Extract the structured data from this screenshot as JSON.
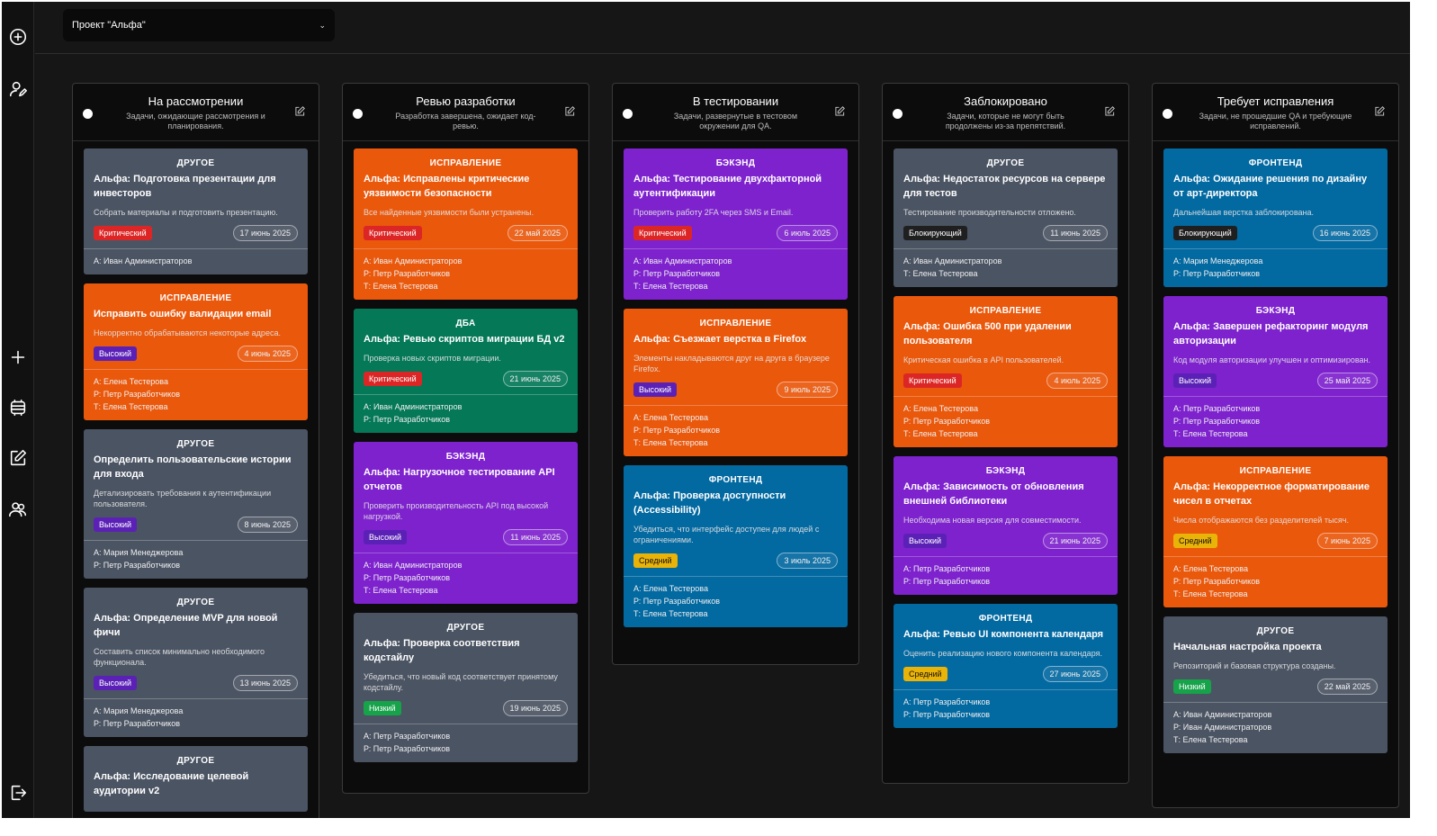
{
  "project_select": {
    "label": "Проект \"Альфа\""
  },
  "columns": [
    {
      "title": "На рассмотрении",
      "desc": "Задачи, ожидающие рассмотрения и планирования.",
      "cards": [
        {
          "type": "ДРУГОЕ",
          "color": "gray",
          "title": "Альфа: Подготовка презентации для инвесторов",
          "desc": "Собрать материалы и подготовить презентацию.",
          "priority": "Критический",
          "prio_class": "critical",
          "date": "17 июнь 2025",
          "people": [
            "А: Иван Администраторов"
          ]
        },
        {
          "type": "ИСПРАВЛЕНИЕ",
          "color": "orange",
          "title": "Исправить ошибку валидации email",
          "desc": "Некорректно обрабатываются некоторые адреса.",
          "priority": "Высокий",
          "prio_class": "high",
          "date": "4 июнь 2025",
          "people": [
            "А: Елена Тестерова",
            "Р: Петр Разработчиков",
            "Т: Елена Тестерова"
          ]
        },
        {
          "type": "ДРУГОЕ",
          "color": "gray",
          "title": "Определить пользовательские истории для входа",
          "desc": "Детализировать требования к аутентификации пользователя.",
          "priority": "Высокий",
          "prio_class": "high",
          "date": "8 июнь 2025",
          "people": [
            "А: Мария Менеджерова",
            "Р: Петр Разработчиков"
          ]
        },
        {
          "type": "ДРУГОЕ",
          "color": "gray",
          "title": "Альфа: Определение MVP для новой фичи",
          "desc": "Составить список минимально необходимого функционала.",
          "priority": "Высокий",
          "prio_class": "high",
          "date": "13 июнь 2025",
          "people": [
            "А: Мария Менеджерова",
            "Р: Петр Разработчиков"
          ]
        },
        {
          "type": "ДРУГОЕ",
          "color": "gray",
          "title": "Альфа: Исследование целевой аудитории v2",
          "desc": "",
          "priority": "",
          "prio_class": "",
          "date": "",
          "people": []
        }
      ]
    },
    {
      "title": "Ревью разработки",
      "desc": "Разработка завершена, ожидает код-ревью.",
      "cards": [
        {
          "type": "ИСПРАВЛЕНИЕ",
          "color": "orange",
          "title": "Альфа: Исправлены критические уязвимости безопасности",
          "desc": "Все найденные уязвимости были устранены.",
          "priority": "Критический",
          "prio_class": "critical",
          "date": "22 май 2025",
          "people": [
            "А: Иван Администраторов",
            "Р: Петр Разработчиков",
            "Т: Елена Тестерова"
          ]
        },
        {
          "type": "ДБА",
          "color": "green",
          "title": "Альфа: Ревью скриптов миграции БД v2",
          "desc": "Проверка новых скриптов миграции.",
          "priority": "Критический",
          "prio_class": "critical",
          "date": "21 июнь 2025",
          "people": [
            "А: Иван Администраторов",
            "Р: Петр Разработчиков"
          ]
        },
        {
          "type": "БЭКЭНД",
          "color": "purple",
          "title": "Альфа: Нагрузочное тестирование API отчетов",
          "desc": "Проверить производительность API под высокой нагрузкой.",
          "priority": "Высокий",
          "prio_class": "high",
          "date": "11 июнь 2025",
          "people": [
            "А: Иван Администраторов",
            "Р: Петр Разработчиков",
            "Т: Елена Тестерова"
          ]
        },
        {
          "type": "ДРУГОЕ",
          "color": "gray",
          "title": "Альфа: Проверка соответствия кодстайлу",
          "desc": "Убедиться, что новый код соответствует принятому кодстайлу.",
          "priority": "Низкий",
          "prio_class": "low",
          "date": "19 июнь 2025",
          "people": [
            "А: Петр Разработчиков",
            "Р: Петр Разработчиков"
          ]
        }
      ]
    },
    {
      "title": "В тестировании",
      "desc": "Задачи, развернутые в тестовом окружении для QA.",
      "cards": [
        {
          "type": "БЭКЭНД",
          "color": "purple",
          "title": "Альфа: Тестирование двухфакторной аутентификации",
          "desc": "Проверить работу 2FA через SMS и Email.",
          "priority": "Критический",
          "prio_class": "critical",
          "date": "6 июль 2025",
          "people": [
            "А: Иван Администраторов",
            "Р: Петр Разработчиков",
            "Т: Елена Тестерова"
          ]
        },
        {
          "type": "ИСПРАВЛЕНИЕ",
          "color": "orange",
          "title": "Альфа: Съезжает верстка в Firefox",
          "desc": "Элементы накладываются друг на друга в браузере Firefox.",
          "priority": "Высокий",
          "prio_class": "high",
          "date": "9 июль 2025",
          "people": [
            "А: Елена Тестерова",
            "Р: Петр Разработчиков",
            "Т: Елена Тестерова"
          ]
        },
        {
          "type": "ФРОНТЕНД",
          "color": "blue",
          "title": "Альфа: Проверка доступности (Accessibility)",
          "desc": "Убедиться, что интерфейс доступен для людей с ограничениями.",
          "priority": "Средний",
          "prio_class": "mid",
          "date": "3 июль 2025",
          "people": [
            "А: Елена Тестерова",
            "Р: Петр Разработчиков",
            "Т: Елена Тестерова"
          ]
        }
      ]
    },
    {
      "title": "Заблокировано",
      "desc": "Задачи, которые не могут быть продолжены из-за препятствий.",
      "cards": [
        {
          "type": "ДРУГОЕ",
          "color": "gray",
          "title": "Альфа: Недостаток ресурсов на сервере для тестов",
          "desc": "Тестирование производительности отложено.",
          "priority": "Блокирующий",
          "prio_class": "block",
          "date": "11 июнь 2025",
          "people": [
            "А: Иван Администраторов",
            "Т: Елена Тестерова"
          ]
        },
        {
          "type": "ИСПРАВЛЕНИЕ",
          "color": "orange",
          "title": "Альфа: Ошибка 500 при удалении пользователя",
          "desc": "Критическая ошибка в API пользователей.",
          "priority": "Критический",
          "prio_class": "critical",
          "date": "4 июль 2025",
          "people": [
            "А: Елена Тестерова",
            "Р: Петр Разработчиков",
            "Т: Елена Тестерова"
          ]
        },
        {
          "type": "БЭКЭНД",
          "color": "purple",
          "title": "Альфа: Зависимость от обновления внешней библиотеки",
          "desc": "Необходима новая версия для совместимости.",
          "priority": "Высокий",
          "prio_class": "high",
          "date": "21 июнь 2025",
          "people": [
            "А: Петр Разработчиков",
            "Р: Петр Разработчиков"
          ]
        },
        {
          "type": "ФРОНТЕНД",
          "color": "blue",
          "title": "Альфа: Ревью UI компонента календаря",
          "desc": "Оценить реализацию нового компонента календаря.",
          "priority": "Средний",
          "prio_class": "mid",
          "date": "27 июнь 2025",
          "people": [
            "А: Петр Разработчиков",
            "Р: Петр Разработчиков"
          ]
        }
      ]
    },
    {
      "title": "Требует исправления",
      "desc": "Задачи, не прошедшие QA и требующие исправлений.",
      "cards": [
        {
          "type": "ФРОНТЕНД",
          "color": "blue",
          "title": "Альфа: Ожидание решения по дизайну от арт-директора",
          "desc": "Дальнейшая верстка заблокирована.",
          "priority": "Блокирующий",
          "prio_class": "block",
          "date": "16 июнь 2025",
          "people": [
            "А: Мария Менеджерова",
            "Р: Петр Разработчиков"
          ]
        },
        {
          "type": "БЭКЭНД",
          "color": "purple",
          "title": "Альфа: Завершен рефакторинг модуля авторизации",
          "desc": "Код модуля авторизации улучшен и оптимизирован.",
          "priority": "Высокий",
          "prio_class": "high",
          "date": "25 май 2025",
          "people": [
            "А: Петр Разработчиков",
            "Р: Петр Разработчиков",
            "Т: Елена Тестерова"
          ]
        },
        {
          "type": "ИСПРАВЛЕНИЕ",
          "color": "orange",
          "title": "Альфа: Некорректное форматирование чисел в отчетах",
          "desc": "Числа отображаются без разделителей тысяч.",
          "priority": "Средний",
          "prio_class": "mid",
          "date": "7 июнь 2025",
          "people": [
            "А: Елена Тестерова",
            "Р: Петр Разработчиков",
            "Т: Елена Тестерова"
          ]
        },
        {
          "type": "ДРУГОЕ",
          "color": "gray",
          "title": "Начальная настройка проекта",
          "desc": "Репозиторий и базовая структура созданы.",
          "priority": "Низкий",
          "prio_class": "low",
          "date": "22 май 2025",
          "people": [
            "А: Иван Администраторов",
            "Р: Иван Администраторов",
            "Т: Елена Тестерова"
          ]
        }
      ]
    }
  ]
}
